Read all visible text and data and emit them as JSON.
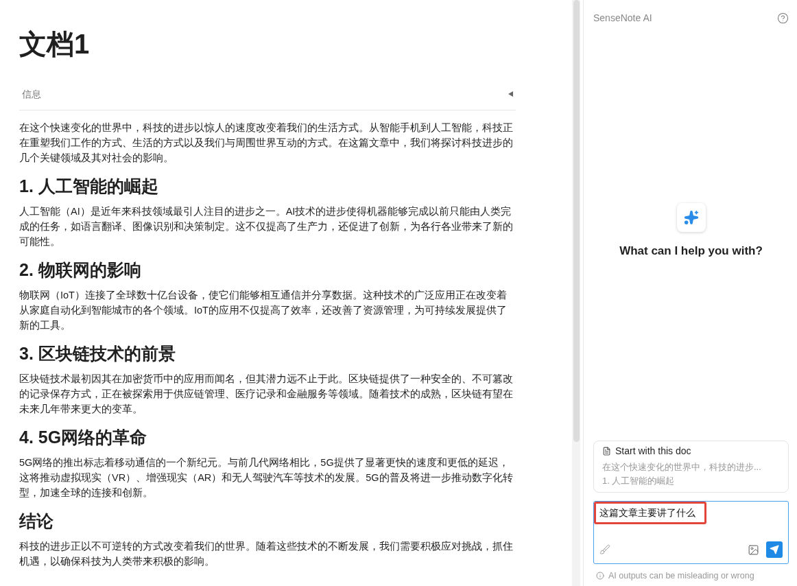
{
  "document": {
    "title": "文档1",
    "info_section": {
      "label": "信息",
      "expanded": false
    },
    "blocks": [
      {
        "kind": "paragraph",
        "text": "在这个快速变化的世界中，科技的进步以惊人的速度改变着我们的生活方式。从智能手机到人工智能，科技正在重塑我们工作的方式、生活的方式以及我们与周围世界互动的方式。在这篇文章中，我们将探讨科技进步的几个关键领域及其对社会的影响。"
      },
      {
        "kind": "heading",
        "text": "1. 人工智能的崛起"
      },
      {
        "kind": "paragraph",
        "text": "人工智能（AI）是近年来科技领域最引人注目的进步之一。AI技术的进步使得机器能够完成以前只能由人类完成的任务，如语言翻译、图像识别和决策制定。这不仅提高了生产力，还促进了创新，为各行各业带来了新的可能性。"
      },
      {
        "kind": "heading",
        "text": "2. 物联网的影响"
      },
      {
        "kind": "paragraph",
        "text": "物联网（IoT）连接了全球数十亿台设备，使它们能够相互通信并分享数据。这种技术的广泛应用正在改变着从家庭自动化到智能城市的各个领域。IoT的应用不仅提高了效率，还改善了资源管理，为可持续发展提供了新的工具。"
      },
      {
        "kind": "heading",
        "text": "3. 区块链技术的前景"
      },
      {
        "kind": "paragraph",
        "text": "区块链技术最初因其在加密货币中的应用而闻名，但其潜力远不止于此。区块链提供了一种安全的、不可篡改的记录保存方式，正在被探索用于供应链管理、医疗记录和金融服务等领域。随着技术的成熟，区块链有望在未来几年带来更大的变革。"
      },
      {
        "kind": "heading",
        "text": "4. 5G网络的革命"
      },
      {
        "kind": "paragraph",
        "text": "5G网络的推出标志着移动通信的一个新纪元。与前几代网络相比，5G提供了显著更快的速度和更低的延迟，这将推动虚拟现实（VR）、增强现实（AR）和无人驾驶汽车等技术的发展。5G的普及将进一步推动数字化转型，加速全球的连接和创新。"
      },
      {
        "kind": "heading",
        "text": "结论"
      },
      {
        "kind": "paragraph",
        "text": "科技的进步正以不可逆转的方式改变着我们的世界。随着这些技术的不断发展，我们需要积极应对挑战，抓住机遇，以确保科技为人类带来积极的影响。"
      }
    ]
  },
  "assistant": {
    "title": "SenseNote AI",
    "prompt": "What can I help you with?",
    "suggestion": {
      "title": "Start with this doc",
      "lines": [
        "在这个快速变化的世界中，科技的进步...",
        "1. 人工智能的崛起"
      ]
    },
    "input": {
      "value": "这篇文章主要讲了什么",
      "highlighted": true
    },
    "disclaimer": "AI outputs can be misleading or wrong"
  }
}
